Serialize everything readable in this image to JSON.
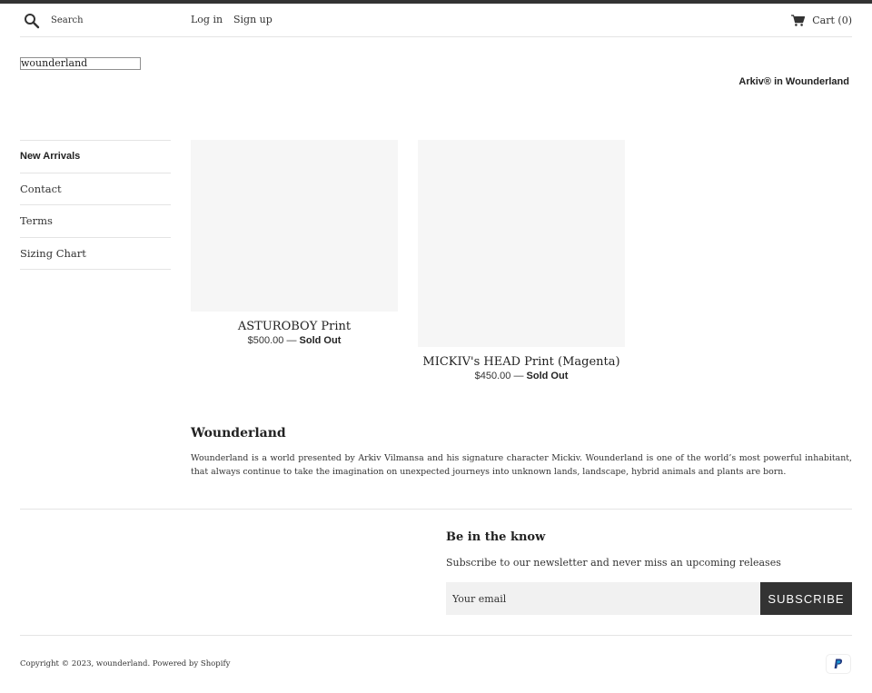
{
  "header": {
    "search_placeholder": "Search",
    "login_label": "Log in",
    "signup_label": "Sign up",
    "cart_label": "Cart (0)"
  },
  "site": {
    "logo_alt": "wounderland"
  },
  "page": {
    "title": "Arkiv® in Wounderland"
  },
  "sidebar": {
    "items": [
      {
        "label": "New Arrivals",
        "active": true
      },
      {
        "label": "Contact"
      },
      {
        "label": "Terms"
      },
      {
        "label": "Sizing Chart"
      }
    ]
  },
  "products": [
    {
      "name": "ASTUROBOY Print",
      "price": "$500.00",
      "separator": " — ",
      "status": "Sold Out"
    },
    {
      "name": "MICKIV's HEAD Print (Magenta)",
      "price": "$450.00",
      "separator": " — ",
      "status": "Sold Out"
    }
  ],
  "collection": {
    "title": "Wounderland",
    "description": "Wounderland is a world presented by Arkiv Vilmansa and his signature character Mickiv. Wounderland is one of the world’s most powerful inhabitant, that always continue to take the imagination on unexpected journeys into unknown lands, landscape, hybrid animals and plants are born."
  },
  "newsletter": {
    "title": "Be in the know",
    "text": "Subscribe to our newsletter and never miss an upcoming releases",
    "email_placeholder": "Your email",
    "subscribe_label": "SUBSCRIBE"
  },
  "footer": {
    "copyright": "Copyright © 2023, wounderland. Powered by Shopify",
    "payment_icon": "paypal-icon"
  },
  "colors": {
    "dark": "#333333",
    "placeholder_bg": "#f6f6f6",
    "input_bg": "#f1f1f1",
    "border": "#e4e4e4"
  }
}
